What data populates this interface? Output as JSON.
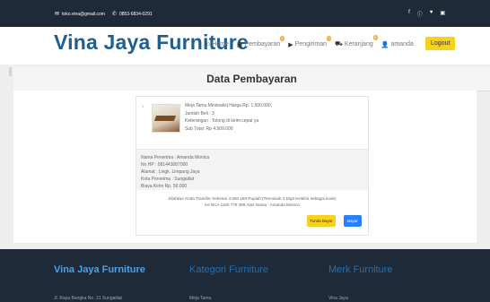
{
  "topbar": {
    "email": "toko.vina@gmail.com",
    "phone": "0853-6834-0291",
    "social_icons": [
      "f",
      "ⓘ",
      "♥",
      "▣"
    ]
  },
  "nav": {
    "brand": "Vina Jaya Furniture",
    "home": "Home",
    "pembayaran": "Pembayaran",
    "pembayaran_badge": "1",
    "pengiriman": "Pengiriman",
    "pengiriman_badge": "0",
    "keranjang": "Keranjang",
    "keranjang_badge": "0",
    "user": "amanda",
    "logout": "Logout"
  },
  "page": {
    "title": "Data Pembayaran"
  },
  "order": {
    "row_no": "1",
    "item_lines": [
      "Meja Tamu Minimalis| Harga Rp. 1.500.000,",
      "Jumlah Beli : 3",
      "Keterangan : Tolong di kirim cepat ya",
      "Sub Total: Rp 4.500.000"
    ],
    "ship_lines": [
      "Nama Penerima : Amanda Monica",
      "No HP : 081443087000",
      "Alamat : Lingk. Limpang Jaya",
      "Kota Penerima : Sungailiat",
      "Biaya Kirim Rp. 50.000"
    ],
    "note_line1": "Silahkan Anda Transfer Sebesar 4.550.168 Rupiah (Termasuk 3 Digit terakhir sebagai kode)",
    "note_line2": "Ke BCA 1180 779 388 Atas Nama : Amanda Monica",
    "btn_later": "Tunda Bayar",
    "btn_pay": "Bayar"
  },
  "footer": {
    "brand": "Vina Jaya Furniture",
    "kategori": "Kategori Furniture",
    "merk": "Merk Furniture",
    "sub_a": "Jl. Raya Bangka No. 21 Sungailiat",
    "sub_b": "Meja Tamu",
    "sub_c": "Vina Jaya"
  }
}
